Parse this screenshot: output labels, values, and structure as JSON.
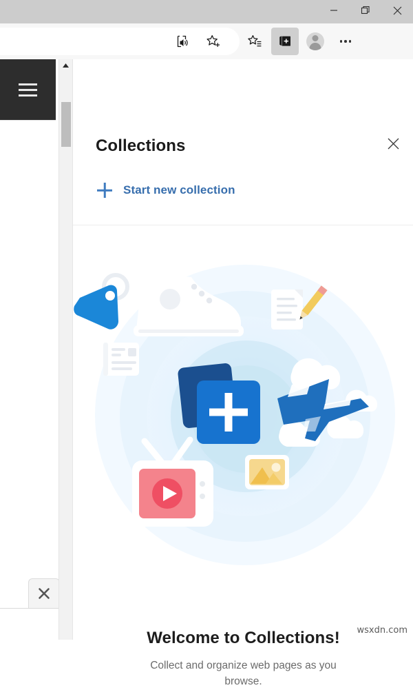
{
  "window": {
    "controls": [
      {
        "name": "minimize-button",
        "label": "Minimize"
      },
      {
        "name": "restore-button",
        "label": "Restore"
      },
      {
        "name": "close-window-button",
        "label": "Close"
      }
    ]
  },
  "toolbar": {
    "read_aloud_label": "Read aloud",
    "add_favorite_label": "Add this page to favorites",
    "favorites_label": "Favorites",
    "collections_label": "Collections",
    "profile_label": "Profile",
    "more_label": "Settings and more"
  },
  "browser": {
    "menu_label": "Menu",
    "close_tab_label": "Close"
  },
  "scrollbar": {
    "up_arrow_label": "Scroll up"
  },
  "panel": {
    "title": "Collections",
    "close_label": "Close",
    "start_new_collection": "Start new collection"
  },
  "empty_state": {
    "title": "Welcome to Collections!",
    "subtitle": "Collect and organize web pages as you browse.",
    "illustration_items": [
      "price-tag",
      "sneaker",
      "note-with-pencil",
      "article-card",
      "collections-cards-plus",
      "airplane",
      "clouds",
      "image-placeholder",
      "retro-tv-play"
    ]
  },
  "watermark": {
    "text": "wsxdn.com"
  },
  "colors": {
    "titlebar": "#cccccc",
    "toolbar": "#f7f7f7",
    "accent_blue": "#376ead",
    "link_blue": "#3f7bbf",
    "illustration_blue_dark": "#1c5a9e",
    "illustration_blue": "#1773cf",
    "illustration_red": "#f4848c",
    "illustration_yellow": "#f5c451",
    "halo_blue": "#d8ebf8"
  }
}
